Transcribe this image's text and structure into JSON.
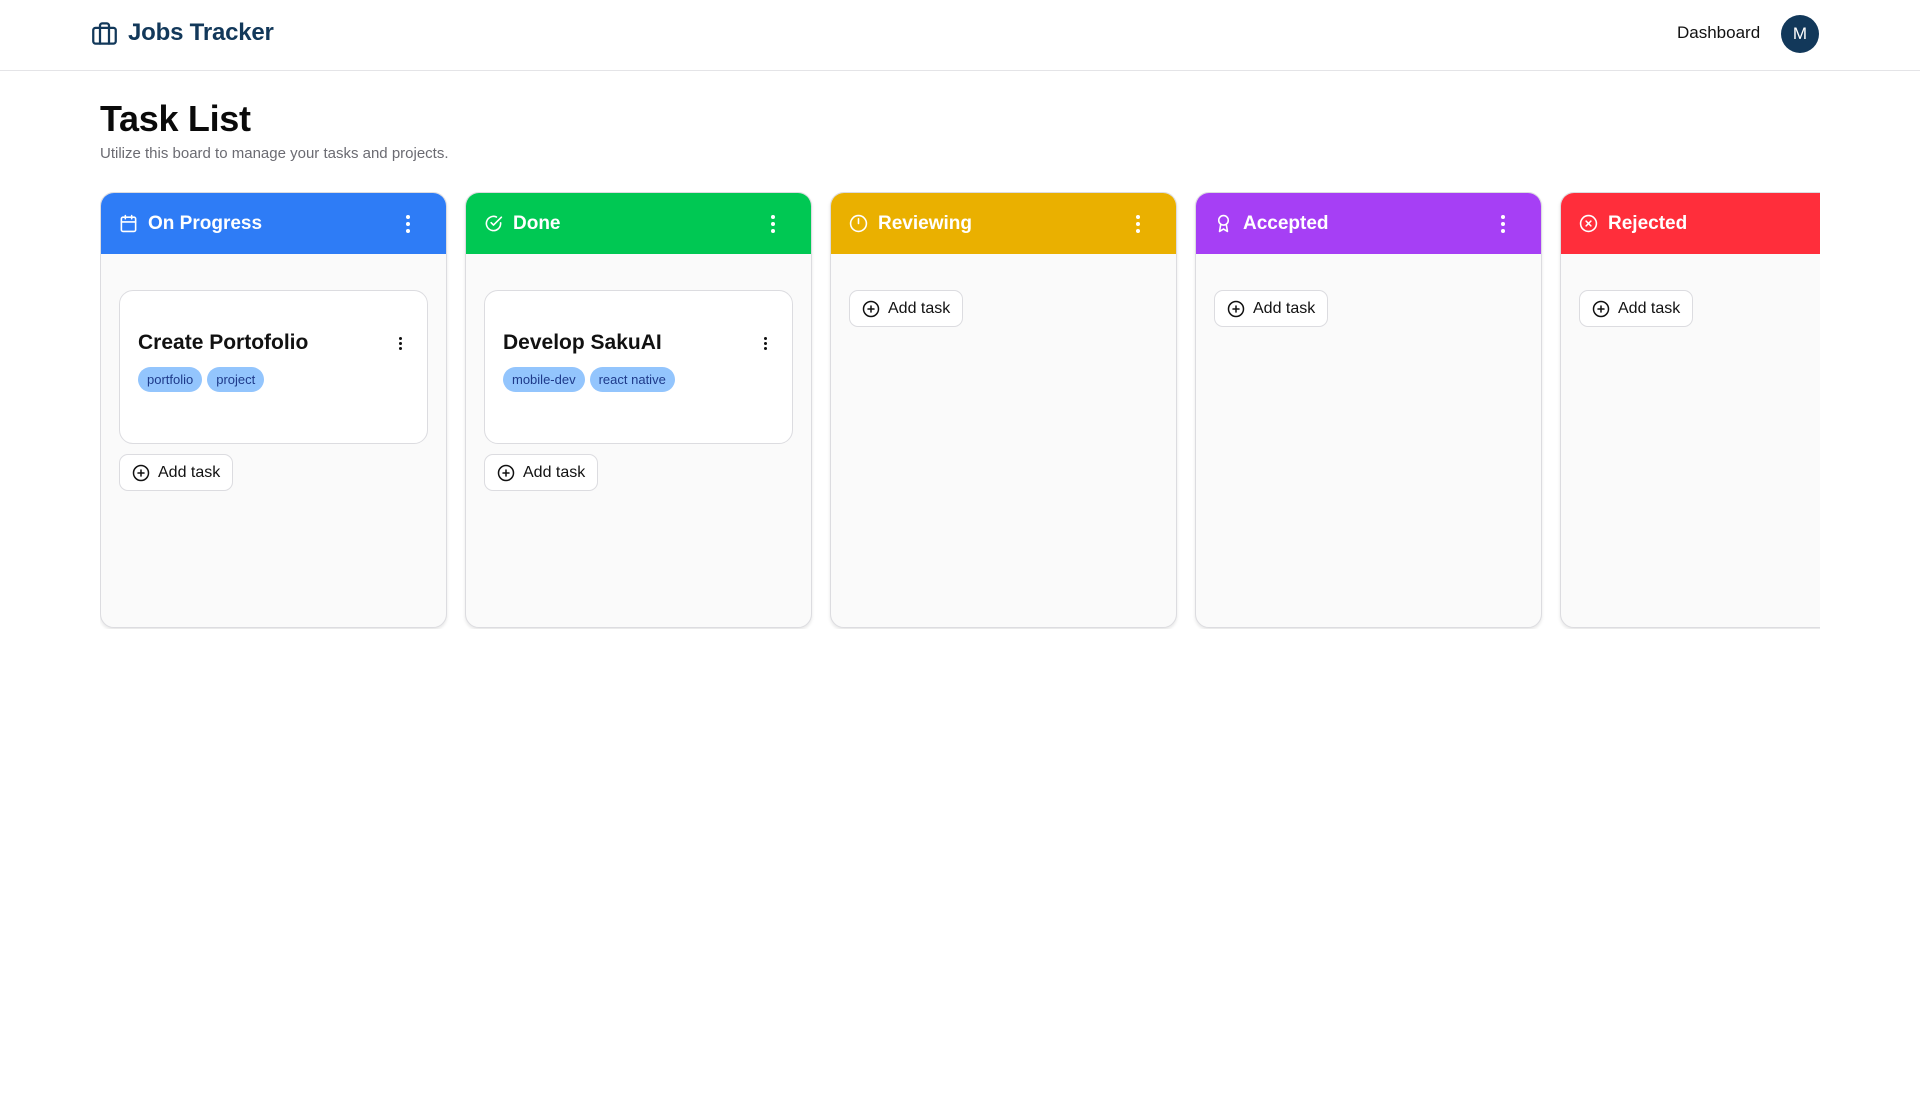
{
  "header": {
    "brand": "Jobs Tracker",
    "brand_icon": "briefcase-icon",
    "nav_dashboard": "Dashboard",
    "avatar_initial": "M"
  },
  "page": {
    "title": "Task List",
    "subtitle": "Utilize this board to manage your tasks and projects."
  },
  "columns": [
    {
      "title": "On Progress",
      "icon": "calendar-icon",
      "color": "#2e7cf6",
      "add_label": "Add task",
      "tasks": [
        {
          "title": "Create Portofolio",
          "tags": [
            "portfolio",
            "project"
          ]
        }
      ]
    },
    {
      "title": "Done",
      "icon": "check-circle-icon",
      "color": "#00c853",
      "add_label": "Add task",
      "tasks": [
        {
          "title": "Develop SakuAI",
          "tags": [
            "mobile-dev",
            "react native"
          ]
        }
      ]
    },
    {
      "title": "Reviewing",
      "icon": "clock-icon",
      "color": "#eab000",
      "add_label": "Add task",
      "tasks": []
    },
    {
      "title": "Accepted",
      "icon": "award-icon",
      "color": "#a63ff5",
      "add_label": "Add task",
      "tasks": []
    },
    {
      "title": "Rejected",
      "icon": "x-circle-icon",
      "color": "#ff2e3b",
      "add_label": "Add task",
      "tasks": []
    }
  ]
}
